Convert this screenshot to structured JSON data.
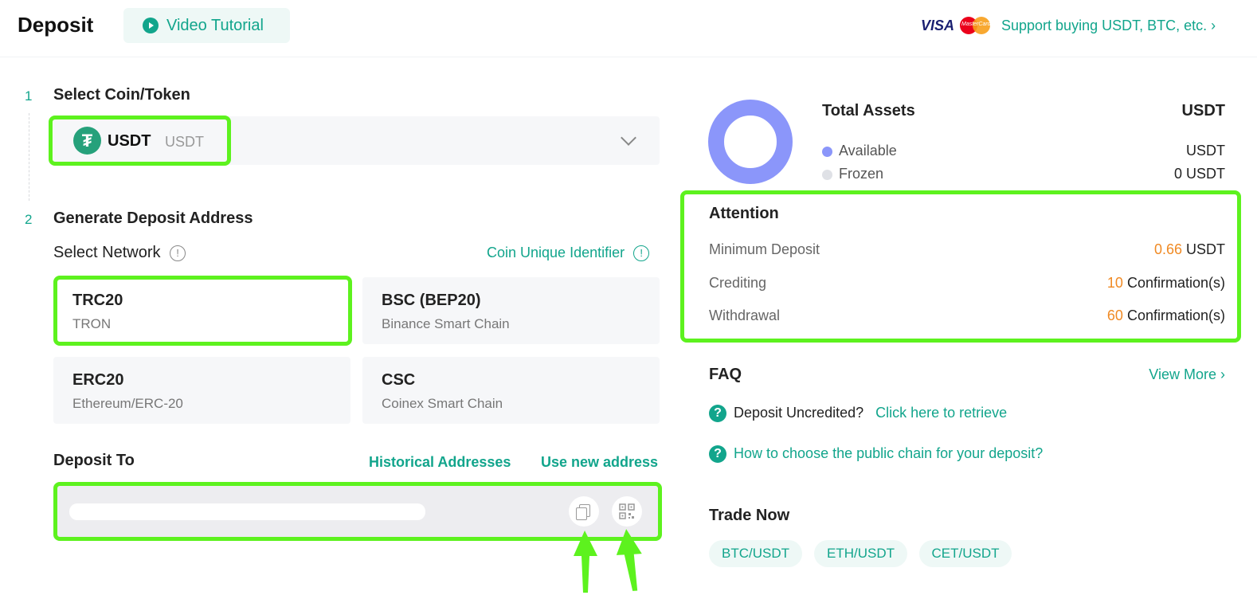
{
  "header": {
    "title": "Deposit",
    "video_label": "Video Tutorial",
    "visa_label": "VISA",
    "mastercard_label": "MasterCard",
    "support_label": "Support buying USDT, BTC, etc. ›"
  },
  "steps": {
    "step1_num": "1",
    "step1_title": "Select Coin/Token",
    "step2_num": "2",
    "step2_title": "Generate Deposit Address"
  },
  "coin": {
    "icon": "tether-icon",
    "name": "USDT",
    "sub": "USDT"
  },
  "network": {
    "label": "Select Network",
    "coin_id_link": "Coin Unique Identifier",
    "options": [
      {
        "name": "TRC20",
        "chain": "TRON",
        "selected": true
      },
      {
        "name": "BSC (BEP20)",
        "chain": "Binance Smart Chain"
      },
      {
        "name": "ERC20",
        "chain": "Ethereum/ERC-20"
      },
      {
        "name": "CSC",
        "chain": "Coinex Smart Chain"
      }
    ]
  },
  "deposit_to": {
    "label": "Deposit To",
    "historical": "Historical Addresses",
    "new_address": "Use new address"
  },
  "assets": {
    "title": "Total Assets",
    "total_unit": "USDT",
    "available_label": "Available",
    "available_unit": "USDT",
    "frozen_label": "Frozen",
    "frozen_value": "0 USDT",
    "colors": {
      "available": "#8b96fa",
      "frozen": "#dfe1e6"
    }
  },
  "attention": {
    "title": "Attention",
    "min_label": "Minimum Deposit",
    "min_value": "0.66",
    "min_unit": "USDT",
    "credit_label": "Crediting",
    "credit_value": "10",
    "credit_unit": "Confirmation(s)",
    "withdraw_label": "Withdrawal",
    "withdraw_value": "60",
    "withdraw_unit": "Confirmation(s)"
  },
  "faq": {
    "title": "FAQ",
    "view_more": "View More ›",
    "q1": "Deposit Uncredited?",
    "q1_link": "Click here to retrieve",
    "q2": "How to choose the public chain for your deposit?"
  },
  "trade": {
    "title": "Trade Now",
    "pairs": [
      "BTC/USDT",
      "ETH/USDT",
      "CET/USDT"
    ]
  },
  "theme": {
    "accent": "#12a58c",
    "highlight": "#5df21e",
    "orange": "#f08a24"
  }
}
